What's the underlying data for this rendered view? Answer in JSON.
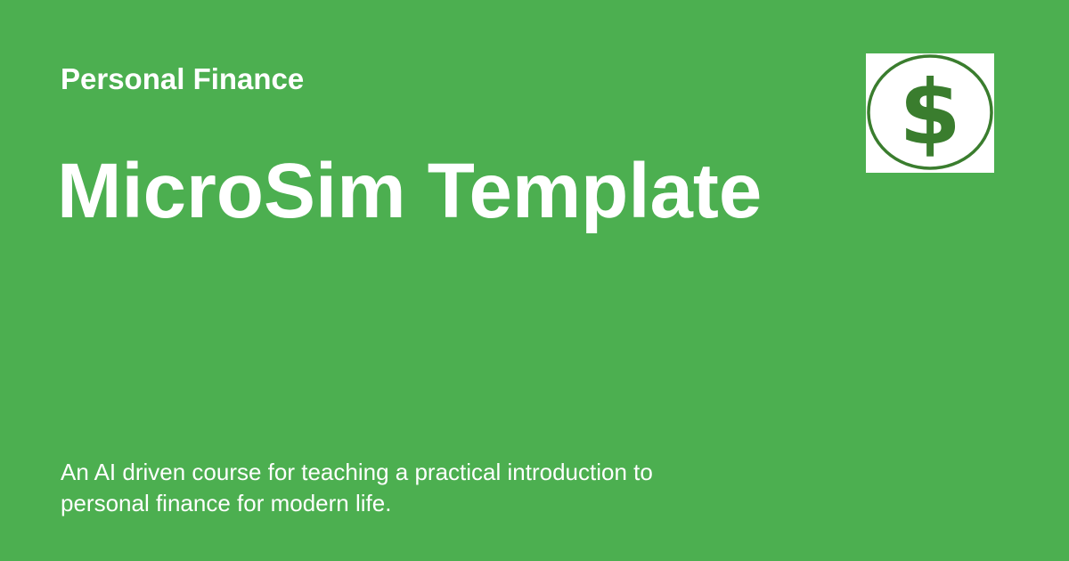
{
  "site_name": "Personal Finance",
  "page_title": "MicroSim Template",
  "description": "An AI driven course for teaching a practical introduction to personal finance for modern life.",
  "logo": {
    "icon": "dollar-sign-icon",
    "symbol": "$",
    "color": "#3A7D2E"
  },
  "colors": {
    "background": "#4CAF50",
    "text": "#FFFFFF",
    "logo_background": "#FFFFFF"
  }
}
